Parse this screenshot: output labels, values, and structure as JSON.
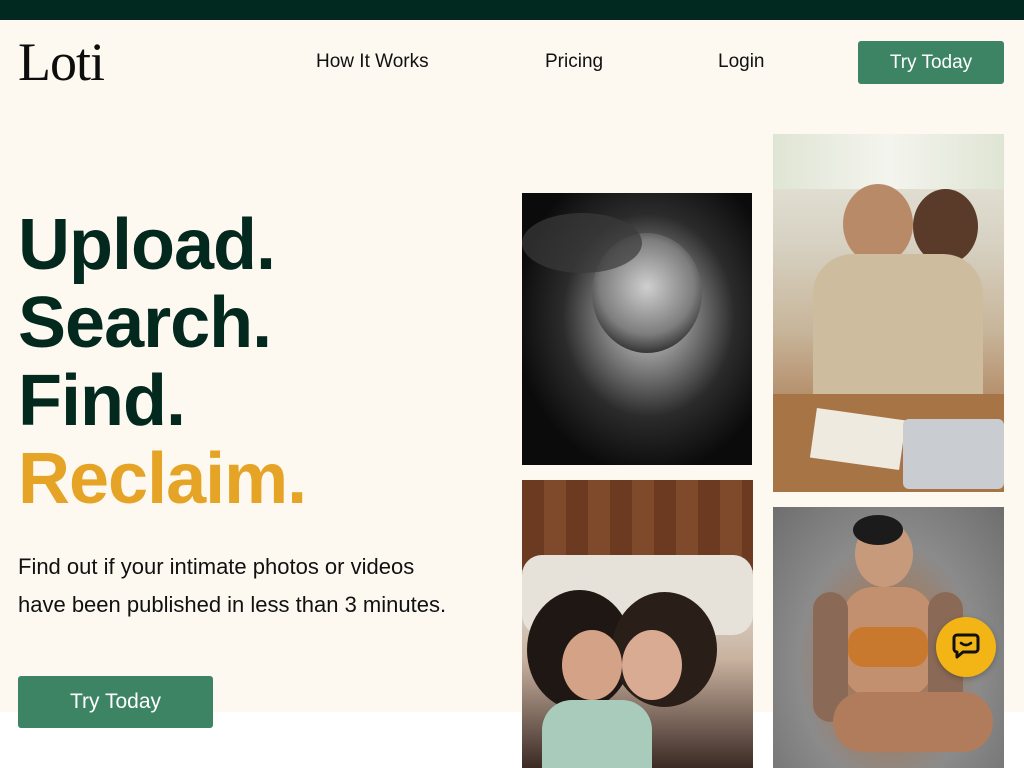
{
  "brand": {
    "logo_text": "Loti"
  },
  "nav": {
    "links": [
      {
        "label": "How It Works"
      },
      {
        "label": "Pricing"
      },
      {
        "label": "Login"
      }
    ],
    "cta_label": "Try Today"
  },
  "hero": {
    "headline": [
      "Upload.",
      "Search.",
      "Find.",
      "Reclaim."
    ],
    "subtext": "Find out if your intimate photos or videos have been published in less than 3 minutes.",
    "cta_label": "Try Today"
  },
  "colors": {
    "brand_dark_green": "#03291f",
    "accent_gold": "#e5a425",
    "button_green": "#3d8465",
    "page_background": "#fdf9f1",
    "chat_yellow": "#f2b515"
  },
  "icons": {
    "chat": "chat-bubble-icon"
  }
}
